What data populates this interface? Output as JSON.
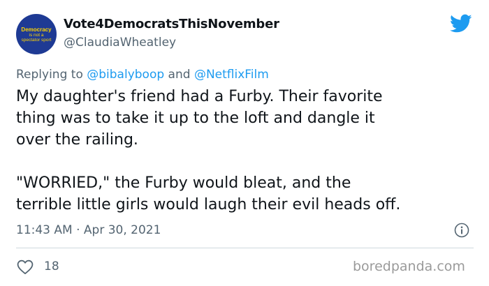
{
  "tweet": {
    "avatar": {
      "line1": "Democracy",
      "line2": "is not a",
      "line3": "spectator sport",
      "bg_color": "#1e3a94",
      "text_color": "#ffd400"
    },
    "display_name": "Vote4DemocratsThisNovember",
    "handle": "@ClaudiaWheatley",
    "bird_icon": "twitter-bird-icon",
    "brand_color": "#1d9bf0",
    "reply": {
      "prefix": "Replying to",
      "mention1": "@bibalyboop",
      "joiner": "and",
      "mention2": "@NetflixFilm"
    },
    "text": {
      "paragraph1": "My daughter's friend had a Furby. Their favorite\nthing was to take it up to the loft and dangle it\nover the railing.",
      "paragraph2": "\"WORRIED,\" the Furby would bleat, and the\nterrible little girls would laugh their evil heads off."
    },
    "meta": {
      "time": "11:43 AM",
      "separator": "·",
      "date": "Apr 30, 2021"
    },
    "info_icon": "info-icon",
    "likes": {
      "icon": "heart-icon",
      "count": "18"
    }
  },
  "watermark": "boredpanda.com"
}
